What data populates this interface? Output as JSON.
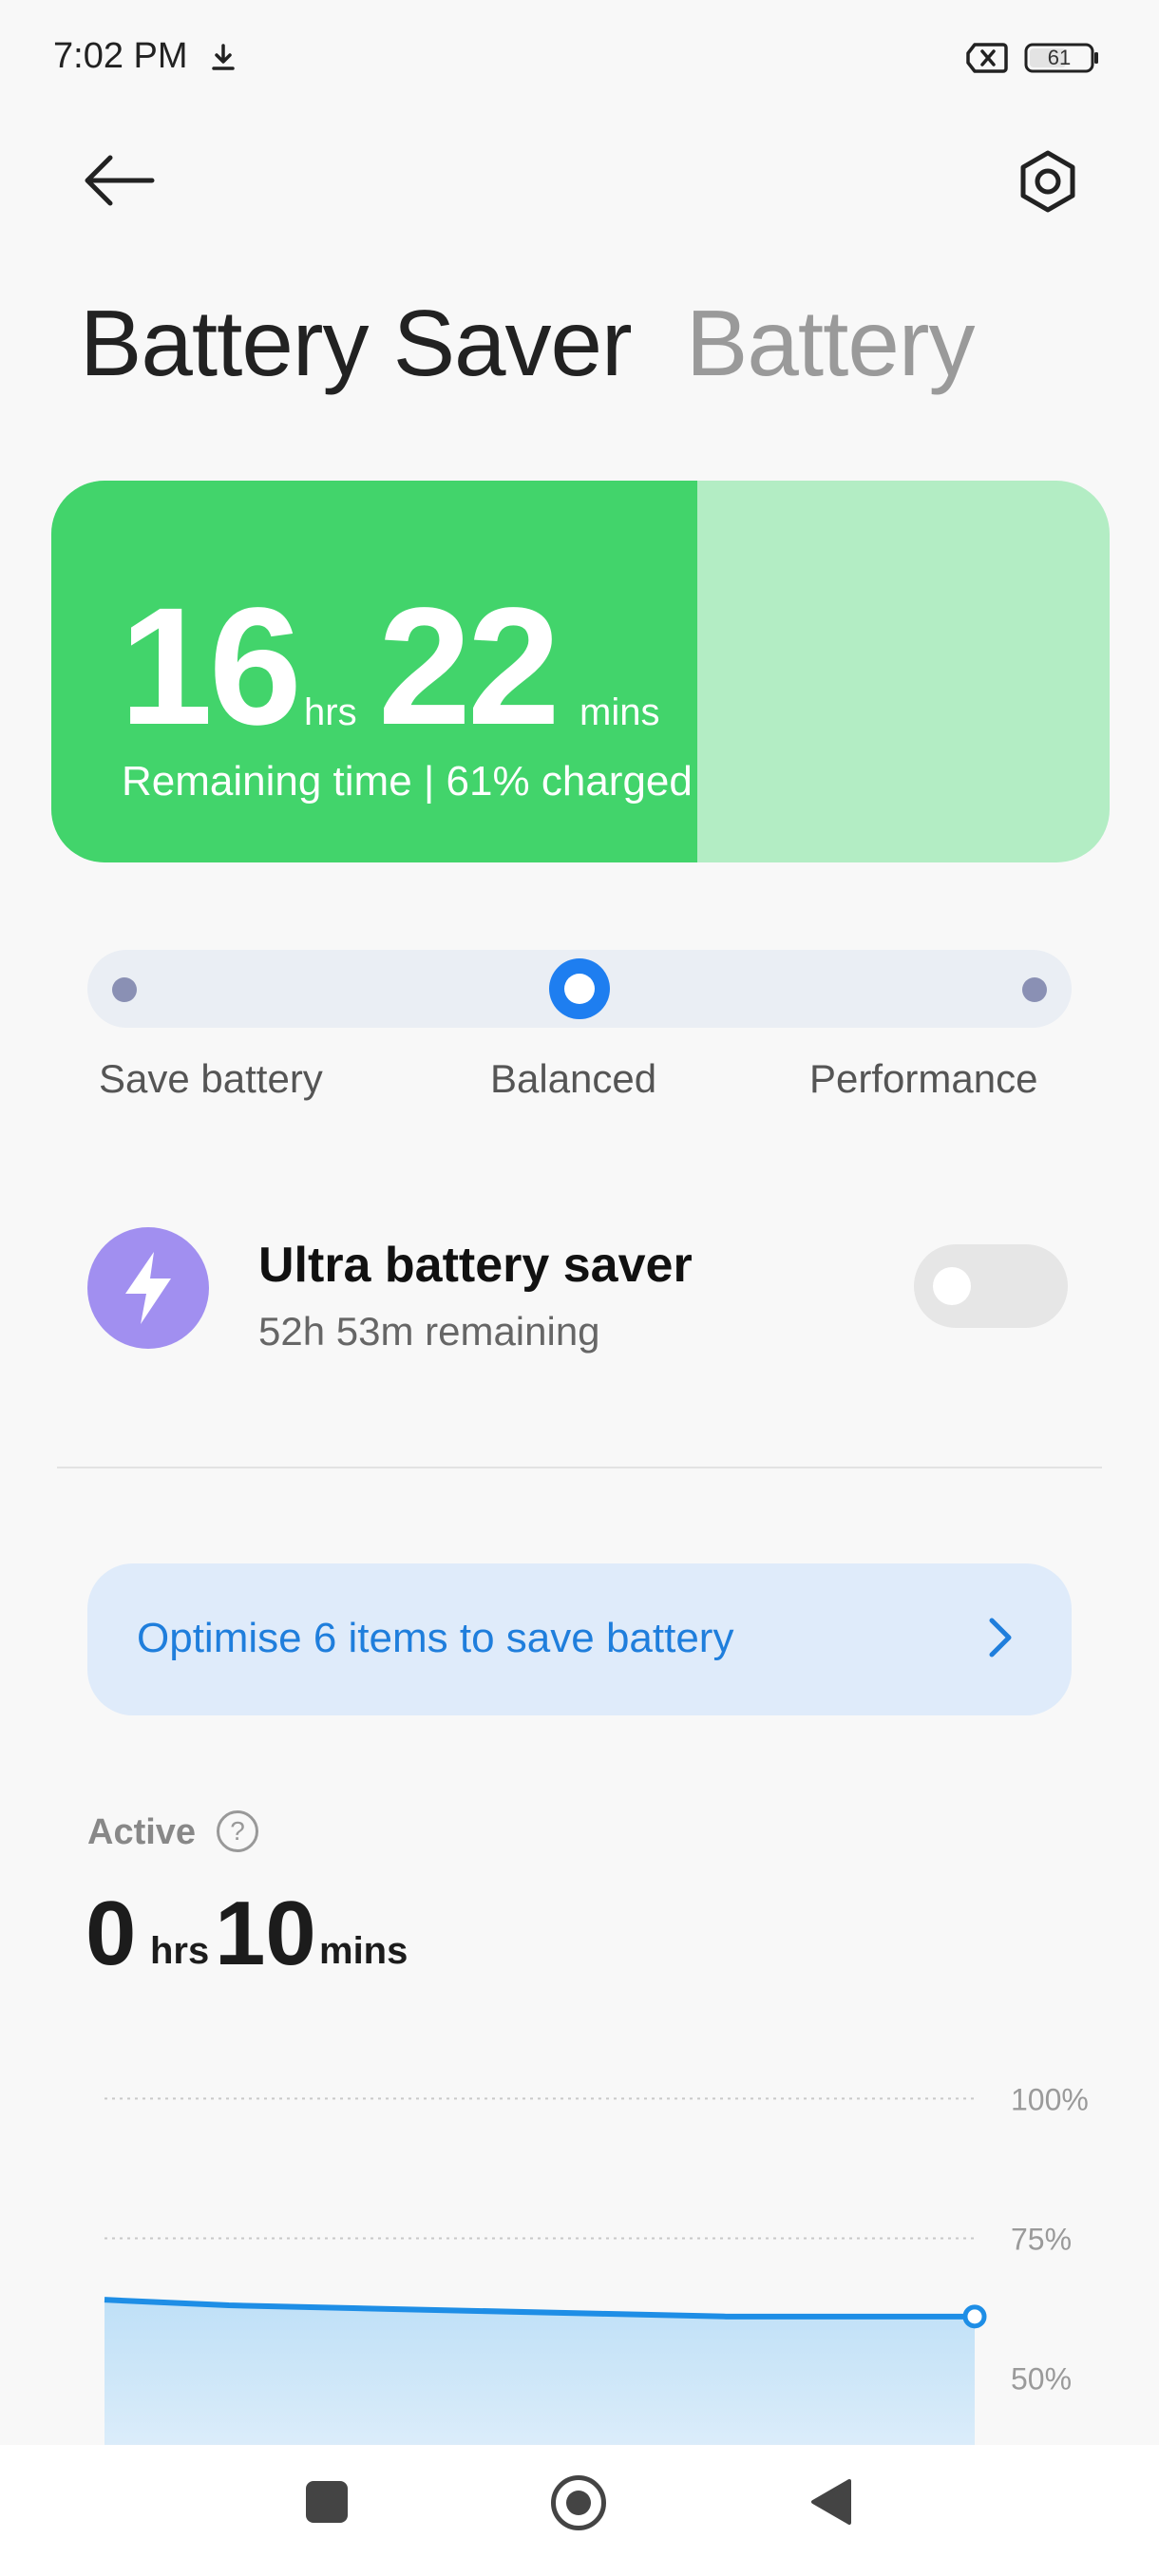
{
  "status_bar": {
    "time": "7:02 PM",
    "battery_level": "61",
    "download_icon": "download-icon",
    "sim_icon": "no-sim-icon",
    "battery_icon": "battery-icon"
  },
  "header": {
    "back_icon": "arrow-left-icon",
    "settings_icon": "gear-icon"
  },
  "tabs": [
    {
      "label": "Battery Saver",
      "active": true
    },
    {
      "label": "Battery",
      "active": false
    }
  ],
  "battery_card": {
    "hours": "16",
    "hours_unit": "hrs",
    "minutes": "22",
    "minutes_unit": "mins",
    "subtitle": "Remaining time | 61% charged",
    "charge_fraction": 0.61,
    "fill_color": "#42d46b",
    "track_color": "#b3edc4"
  },
  "power_mode": {
    "options": [
      "Save battery",
      "Balanced",
      "Performance"
    ],
    "selected": "Balanced",
    "accent_color": "#1e7ef0"
  },
  "ultra_saver": {
    "icon": "lightning-icon",
    "title": "Ultra battery saver",
    "subtitle": "52h 53m remaining",
    "enabled": false
  },
  "optimise": {
    "label": "Optimise 6 items to save battery",
    "chevron_icon": "chevron-right-icon"
  },
  "active": {
    "label": "Active",
    "help_icon": "help-icon",
    "help_glyph": "?",
    "hours": "0",
    "hours_unit": "hrs",
    "minutes": "10",
    "minutes_unit": "mins"
  },
  "chart_data": {
    "type": "area",
    "y_ticks": [
      "100%",
      "75%",
      "50%"
    ],
    "y_tick_values": [
      100,
      75,
      50
    ],
    "ylim": [
      37,
      105
    ],
    "values": [
      64,
      63,
      62.5,
      62,
      61.5,
      61,
      61,
      61
    ],
    "line_color": "#1e8ee6",
    "grid": true
  },
  "nav_bar": {
    "recents_icon": "square-icon",
    "home_icon": "home-circle-icon",
    "back_icon": "triangle-back-icon"
  }
}
